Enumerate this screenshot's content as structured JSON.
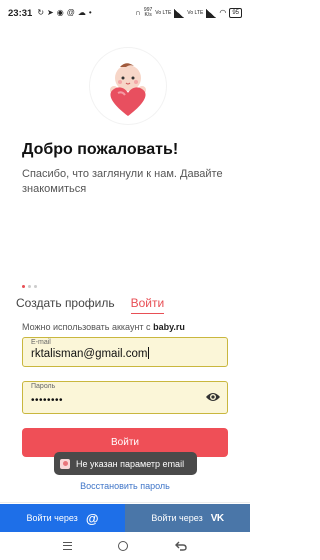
{
  "status_bar": {
    "time": "23:31",
    "battery": "95",
    "net_speed_value": "997",
    "net_speed_unit": "K/s",
    "net1": "Vo LTE",
    "net2": "Vo LTE"
  },
  "welcome": {
    "title": "Добро пожаловать!",
    "subtitle": "Спасибо, что заглянули к нам. Давайте знакомиться"
  },
  "tabs": [
    {
      "label": "Создать профиль",
      "active": false
    },
    {
      "label": "Войти",
      "active": true
    }
  ],
  "hint": {
    "text": "Можно использовать аккаунт с",
    "site": "baby.ru"
  },
  "email_field": {
    "label": "E-mail",
    "value": "rktalisman@gmail.com"
  },
  "password_field": {
    "label": "Пароль",
    "value": "••••••••"
  },
  "login_button": "Войти",
  "toast": "Не указан параметр email",
  "restore_link": "Восстановить пароль",
  "social": {
    "mailru_label": "Войти через",
    "mailru_icon": "@",
    "vk_label": "Войти через",
    "vk_icon": "VK"
  },
  "colors": {
    "accent": "#ef4f57",
    "mailru": "#1e6fe8",
    "vk": "#4a76a8",
    "link": "#3f75c8"
  }
}
